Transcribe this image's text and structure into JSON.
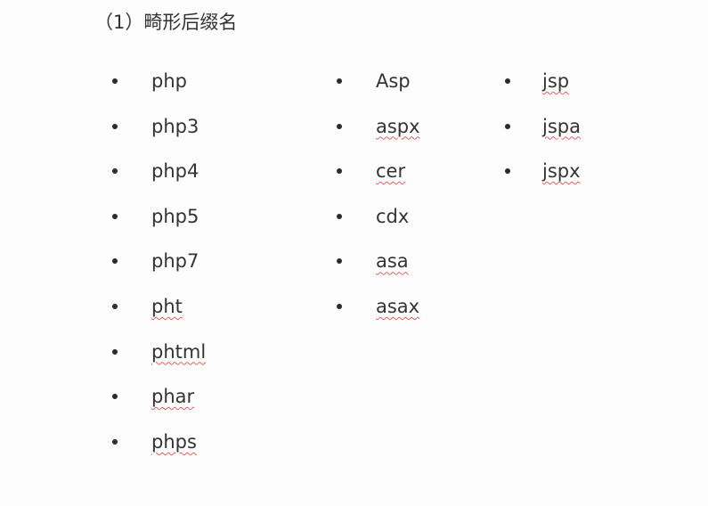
{
  "heading": "（1）畸形后缀名",
  "columns": [
    {
      "items": [
        "php",
        "php3",
        "php4",
        "php5",
        "php7",
        "pht",
        "phtml",
        "phar",
        "phps"
      ]
    },
    {
      "items": [
        "Asp",
        "aspx",
        "cer",
        "cdx",
        "asa",
        "asax"
      ]
    },
    {
      "items": [
        "jsp",
        "jspa",
        "jspx"
      ]
    }
  ]
}
